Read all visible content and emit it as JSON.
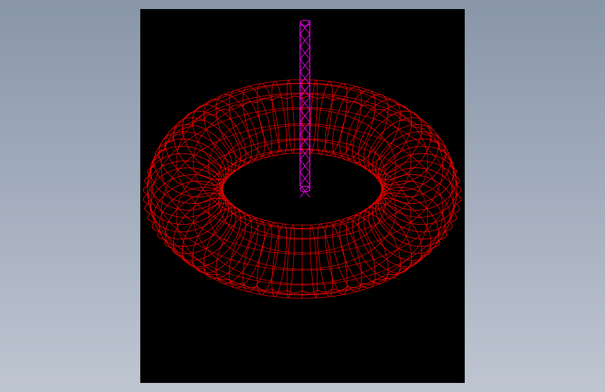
{
  "app": {
    "background_top": "#8996a8",
    "background_bottom": "#bfc6d2"
  },
  "viewport": {
    "background": "#000000",
    "wireframe_color": "#ff0000",
    "shaft_color": "#ff00ff",
    "model": "helical-coil-toroid-with-shaft"
  }
}
